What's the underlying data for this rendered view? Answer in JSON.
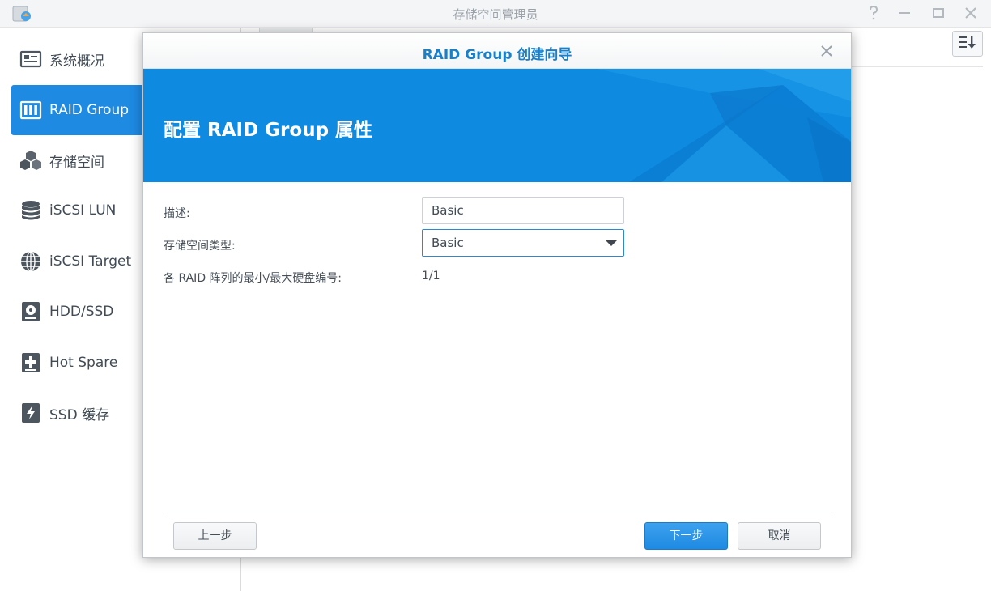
{
  "window": {
    "title": "存储空间管理员",
    "controls": [
      "help-icon",
      "minimize-icon",
      "maximize-icon",
      "close-icon"
    ]
  },
  "sidebar": {
    "items": [
      {
        "label": "系统概况",
        "icon": "overview-icon",
        "active": false
      },
      {
        "label": "RAID Group",
        "icon": "raid-group-icon",
        "active": true
      },
      {
        "label": "存储空间",
        "icon": "storage-cubes-icon",
        "active": false
      },
      {
        "label": "iSCSI LUN",
        "icon": "database-icon",
        "active": false
      },
      {
        "label": "iSCSI Target",
        "icon": "globe-icon",
        "active": false
      },
      {
        "label": "HDD/SSD",
        "icon": "hdd-icon",
        "active": false
      },
      {
        "label": "Hot Spare",
        "icon": "hot-spare-plus-icon",
        "active": false
      },
      {
        "label": "SSD 缓存",
        "icon": "ssd-cache-icon",
        "active": false
      }
    ]
  },
  "dialog": {
    "title": "RAID Group 创建向导",
    "banner_title": "配置 RAID Group 属性",
    "fields": {
      "description_label": "描述:",
      "description_value": "Basic",
      "storage_type_label": "存储空间类型:",
      "storage_type_value": "Basic",
      "disk_count_label": "各 RAID 阵列的最小/最大硬盘编号:",
      "disk_count_value": "1/1"
    },
    "buttons": {
      "back": "上一步",
      "next": "下一步",
      "cancel": "取消"
    }
  },
  "colors": {
    "accent": "#1e8ae2",
    "banner": "#0e8ae0",
    "title_text": "#1a7fc9"
  }
}
